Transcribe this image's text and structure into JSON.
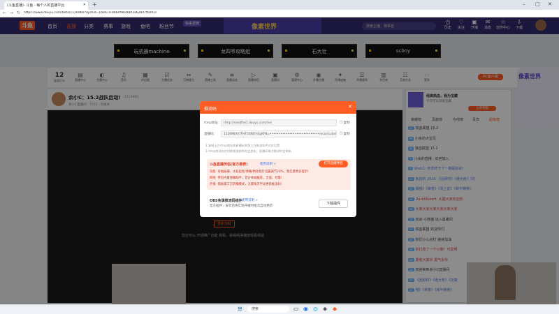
{
  "browser": {
    "tab_title": "(斗鱼直播)- 斗鱼 - 每个人的直播平台",
    "url": "https://www.douyu.com/beta/1126960?dyshid=16b67d-bb60f8b466f3a62847f6001e00091701"
  },
  "header": {
    "logo": "斗鱼",
    "nav": [
      "首页",
      "直播",
      "分类",
      "赛事",
      "游戏",
      "鱼吧",
      "粉丝节"
    ],
    "promo": "像素世界",
    "promo_tag": "快来冒牌",
    "search_placeholder": "搜索主播、赛事名",
    "icons": [
      "历史",
      "关注",
      "开播",
      "消息",
      "创作中心",
      "下载"
    ]
  },
  "games": [
    "玩机器machine",
    "龙四爷攻略组",
    "石大壮",
    "scboy"
  ],
  "toolbar": {
    "counter": "12",
    "counter_label": "连续打卡",
    "tools": [
      "直播中心",
      "主播中心",
      "音乐",
      "AI出图",
      "主播任务",
      "万物接力",
      "直播工具",
      "直播动态",
      "直播伴侣",
      "直播间",
      "管理中心",
      "开播主播",
      "开播攻略",
      "开播规则",
      "节目单",
      "互助任务",
      "更多"
    ]
  },
  "room": {
    "title": "余小C：15.2战队启动!",
    "meta": "余小C直播间 · 7652 · 新媒体",
    "id": "1126960"
  },
  "video": {
    "start_btn": "重新加载",
    "message": "您还可以 开通推广功能 观看，获得纯净播放观看体验"
  },
  "ad": {
    "pc_button": "PC客户端",
    "title": "像素世界"
  },
  "gift": {
    "title": "经典热血，我为宝藏",
    "sub": "今日可以领取宝藏",
    "button": "立即领取"
  },
  "chat": {
    "tabs": [
      "荣耀榜",
      "贡献榜",
      "在线榜",
      "贵宾",
      "超级榜"
    ],
    "rows": [
      {
        "badge": "LV",
        "text": "铁血联盟 15.2",
        "style": ""
      },
      {
        "badge": "钻",
        "text": "小余的大宝贝",
        "style": ""
      },
      {
        "badge": "钻",
        "text": "铁血联盟 15.2",
        "style": ""
      },
      {
        "badge": "V",
        "text": "小余的直播 · 欢迎加入",
        "style": ""
      },
      {
        "badge": "V",
        "text": "Shek1: 怀念终于十一期最好的！",
        "style": "hl"
      },
      {
        "badge": "LV",
        "text": "各自的 2016 《回顾时》《继大枪》《托",
        "style": "hl"
      },
      {
        "badge": "LV",
        "text": "捕哦》《荣誉》《向上前》《和平精英》",
        "style": "hl"
      },
      {
        "badge": "LV",
        "text": "Dark66start: 大聪大家欢迎你",
        "style": "red"
      },
      {
        "badge": "LV",
        "text": "大家大家大家大家大家大家",
        "style": "red"
      },
      {
        "badge": "LV",
        "text": "欢迎 小熊猫 进入直播间",
        "style": ""
      },
      {
        "badge": "LV",
        "text": "铁血联盟 欢迎你们",
        "style": ""
      },
      {
        "badge": "LV",
        "text": "你们小心点打 继续加油",
        "style": ""
      },
      {
        "badge": "LV",
        "text": "你打败了一个小熊！可爱啊",
        "style": "red"
      },
      {
        "badge": "LV",
        "text": "勇者大家好 勇气永存",
        "style": "red"
      },
      {
        "badge": "LV",
        "text": "欢迎来到余小C直播间",
        "style": ""
      },
      {
        "badge": "LV",
        "text": "《回顾时》《继大枪》《托捕",
        "style": "hl"
      },
      {
        "badge": "LV",
        "text": "哦》《荣誉》《和平精英》",
        "style": "hl"
      }
    ]
  },
  "modal": {
    "title": "推流码",
    "rtmp_label": "rtmp地址：",
    "rtmp_value": "rtmp://sendfire1.douyu.com/live",
    "key_label": "直播码：",
    "key_value": "1126960rl7FHF50NO?digKFN=••••••••••••••••••••••••••••record=&vfkno=rd",
    "copy": "复制",
    "copy2": "复制",
    "tip1": "1.复制上方rtmp地址和直播码到第三方推流软件对应位置",
    "tip2": "2.rtmp地址仅仅切换推流结构时会变化，直播码每次推流时会刷新",
    "push_title": "斗鱼直播伴侣(官方推荐)",
    "push_link": "使用说明 >",
    "push_btn": "打开直播伴侣",
    "push_rows": [
      {
        "tag": "功能",
        "text": "有拍插摄、水友起者/弹幕/特效指针设置调节20%，我任意更多提示!"
      },
      {
        "tag": "网络",
        "text": "伴侣内置弹幕助手，官方权威推荐、全面、可靠!"
      },
      {
        "tag": "开播",
        "text": "借助第三方转播模式，无需每天手动更新推流码!"
      }
    ],
    "obs_title": "OBS免填推流码插件",
    "obs_link": "使用说明 >",
    "obs_desc": "官方插件，安装后将实现开播时推流自动更新",
    "obs_btn": "下载插件"
  },
  "taskbar": {
    "search": "搜索"
  }
}
